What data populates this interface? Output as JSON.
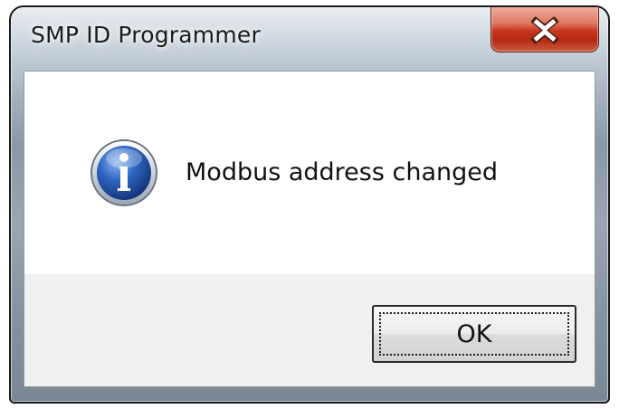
{
  "window": {
    "title": "SMP ID Programmer"
  },
  "titlebar": {
    "close_icon": "close-x-icon"
  },
  "dialog": {
    "icon": "information-icon",
    "message": "Modbus address changed",
    "ok_label": "OK"
  },
  "colors": {
    "close_button": "#c6371f",
    "info_icon": "#2a5fb0"
  }
}
